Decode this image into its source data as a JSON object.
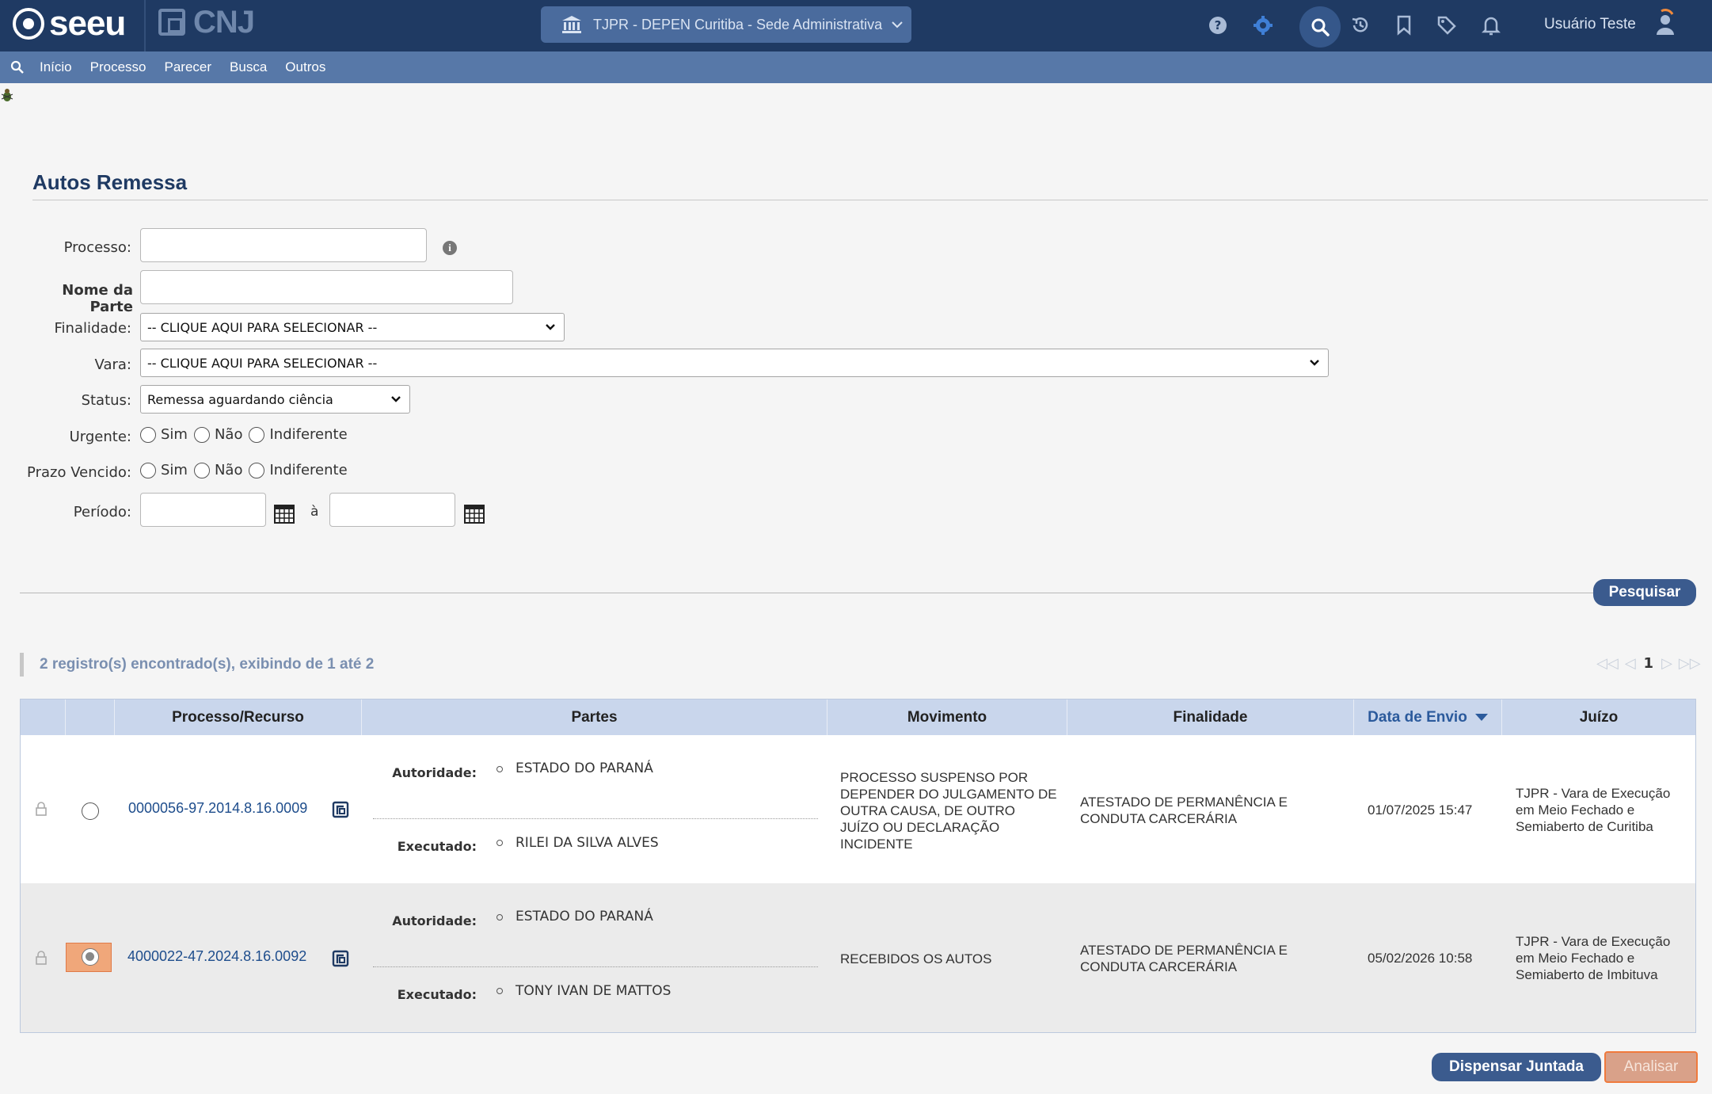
{
  "header": {
    "logo_text": "seeu",
    "cnj_text": "CNJ",
    "unit_selector": "TJPR - DEPEN Curitiba - Sede Administrativa",
    "user_name": "Usuário Teste"
  },
  "menu": {
    "items": [
      "Início",
      "Processo",
      "Parecer",
      "Busca",
      "Outros"
    ]
  },
  "page": {
    "title": "Autos Remessa"
  },
  "form": {
    "processo_label": "Processo:",
    "processo_value": "",
    "nome_parte_label": "Nome da Parte",
    "nome_parte_value": "",
    "finalidade_label": "Finalidade:",
    "finalidade_value": "-- CLIQUE AQUI PARA SELECIONAR --",
    "vara_label": "Vara:",
    "vara_value": "-- CLIQUE AQUI PARA SELECIONAR --",
    "status_label": "Status:",
    "status_value": "Remessa aguardando ciência",
    "urgente_label": "Urgente:",
    "prazo_label": "Prazo Vencido:",
    "radio_options": [
      "Sim",
      "Não",
      "Indiferente"
    ],
    "periodo_label": "Período:",
    "periodo_sep": "à",
    "periodo_from": "",
    "periodo_to": "",
    "search_button": "Pesquisar"
  },
  "results": {
    "summary": "2 registro(s) encontrado(s), exibindo de 1 até 2",
    "current_page": "1",
    "columns": [
      "Processo/Recurso",
      "Partes",
      "Movimento",
      "Finalidade",
      "Data de Envio",
      "Juízo"
    ],
    "rows": [
      {
        "processo": "0000056-97.2014.8.16.0009",
        "autoridade_label": "Autoridade:",
        "autoridade": "ESTADO DO PARANÁ",
        "executado_label": "Executado:",
        "executado": "RILEI DA SILVA ALVES",
        "movimento": [
          "PROCESSO SUSPENSO POR",
          "DEPENDER DO JULGAMENTO DE",
          "OUTRA CAUSA, DE OUTRO",
          "JUÍZO OU DECLARAÇÃO",
          "INCIDENTE"
        ],
        "finalidade": [
          "ATESTADO DE PERMANÊNCIA E",
          "CONDUTA CARCERÁRIA"
        ],
        "data_envio": "01/07/2025 15:47",
        "juizo": [
          "TJPR - Vara de Execução",
          "em Meio Fechado e",
          "Semiaberto de Curitiba"
        ],
        "selected": false
      },
      {
        "processo": "4000022-47.2024.8.16.0092",
        "autoridade_label": "Autoridade:",
        "autoridade": "ESTADO DO PARANÁ",
        "executado_label": "Executado:",
        "executado": "TONY IVAN DE MATTOS",
        "movimento": [
          "RECEBIDOS OS AUTOS"
        ],
        "finalidade": [
          "ATESTADO DE PERMANÊNCIA E",
          "CONDUTA CARCERÁRIA"
        ],
        "data_envio": "05/02/2026 10:58",
        "juizo": [
          "TJPR - Vara de Execução",
          "em Meio Fechado e",
          "Semiaberto de Imbituva"
        ],
        "selected": true
      }
    ]
  },
  "actions": {
    "dispensar": "Dispensar Juntada",
    "analisar": "Analisar"
  },
  "colors": {
    "topbar": "#1f3a63",
    "menubar": "#5778a8",
    "accent": "#3b5b8e",
    "selection": "#f0a77a"
  }
}
